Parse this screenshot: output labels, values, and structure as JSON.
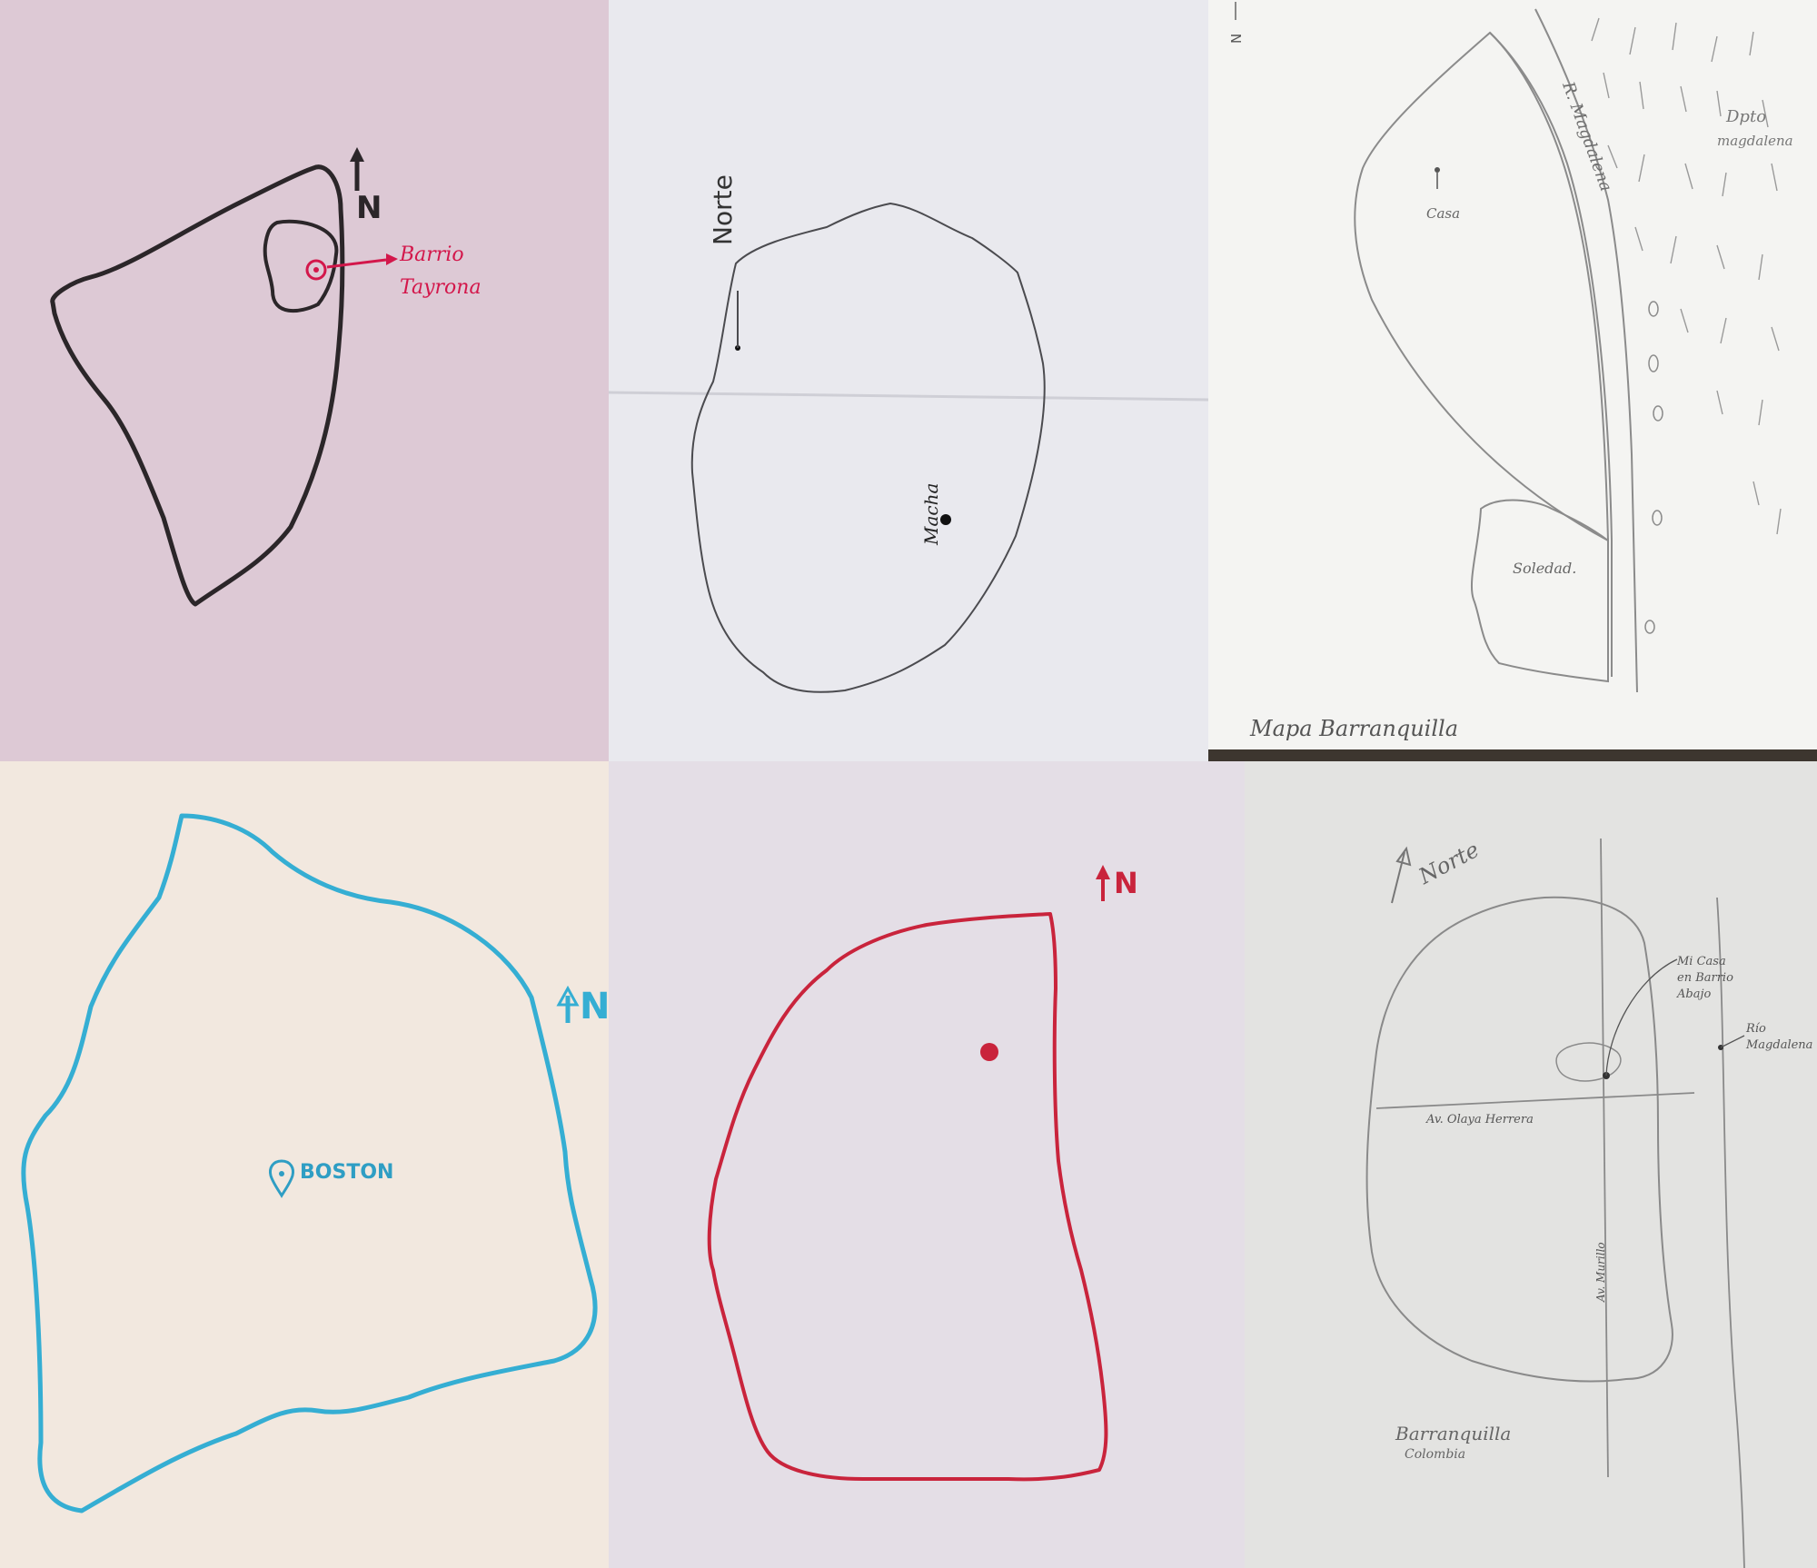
{
  "panels": [
    {
      "id": "p1",
      "bg": "#ddc9d5",
      "stroke": "#2b2629",
      "accent": "#d3174b",
      "north_label": "N",
      "place_label_line1": "Barrio",
      "place_label_line2": "Tayrona"
    },
    {
      "id": "p2",
      "bg": "#e9e9ee",
      "stroke": "#4b4b4f",
      "north_label": "Norte",
      "place_label": "Macha"
    },
    {
      "id": "p3",
      "bg": "#f4f4f2",
      "stroke": "#8b8b8b",
      "north_label": "N",
      "home_label": "Casa",
      "river_label": "R. Magdalena",
      "department_label_line1": "Dpto",
      "department_label_line2": "magdalena",
      "area_label": "Soledad.",
      "title": "Mapa Barranquilla"
    },
    {
      "id": "p4",
      "bg": "#f2e8df",
      "stroke": "#35aed3",
      "north_label": "N",
      "place_label": "BOSTON"
    },
    {
      "id": "p5",
      "bg": "#e4dee6",
      "stroke": "#c9243c",
      "north_label": "N"
    },
    {
      "id": "p6",
      "bg": "#e3e3e1",
      "stroke": "#8a8a8a",
      "north_label": "Norte",
      "home_label_line1": "Mi Casa",
      "home_label_line2": "en Barrio",
      "home_label_line3": "Abajo",
      "river_label_line1": "Río",
      "river_label_line2": "Magdalena",
      "avenue_label_h": "Av. Olaya Herrera",
      "avenue_label_v": "Av. Murillo",
      "city_label": "Barranquilla",
      "country_label": "Colombia"
    }
  ]
}
